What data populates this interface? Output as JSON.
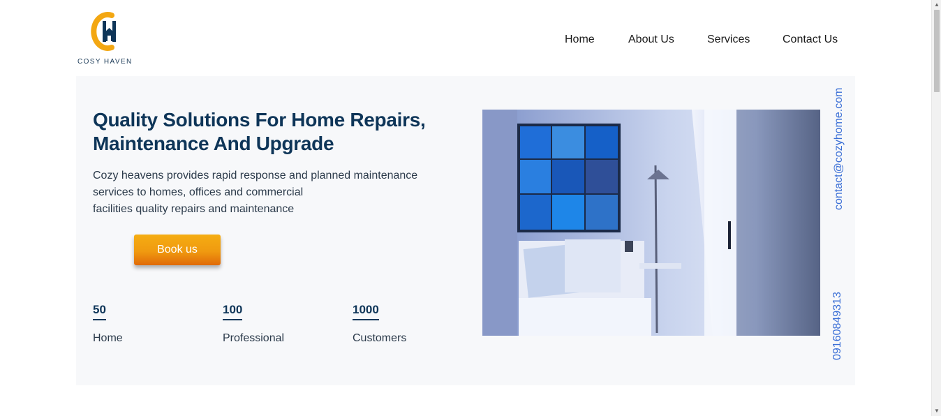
{
  "brand": {
    "logo_text": "COSY HAVEN",
    "colors": {
      "accent": "#f0a30f",
      "navy": "#0e3558",
      "link": "#3b6fd6"
    }
  },
  "nav": {
    "items": [
      {
        "label": "Home"
      },
      {
        "label": "About Us"
      },
      {
        "label": "Services"
      },
      {
        "label": "Contact Us"
      }
    ]
  },
  "hero": {
    "title": "Quality Solutions For Home Repairs, Maintenance And Upgrade",
    "description_lines": [
      "Cozy heavens provides rapid response and planned maintenance",
      "services to homes, offices and commercial",
      "facilities quality repairs and maintenance"
    ],
    "cta_label": "Book us",
    "stats": [
      {
        "value": "50",
        "label": "Home"
      },
      {
        "value": "100",
        "label": "Professional"
      },
      {
        "value": "1000",
        "label": "Customers"
      }
    ],
    "image_icon": "living-room-photo"
  },
  "contact": {
    "email": "contact@cozyhome.com",
    "phone": "09160849313"
  }
}
